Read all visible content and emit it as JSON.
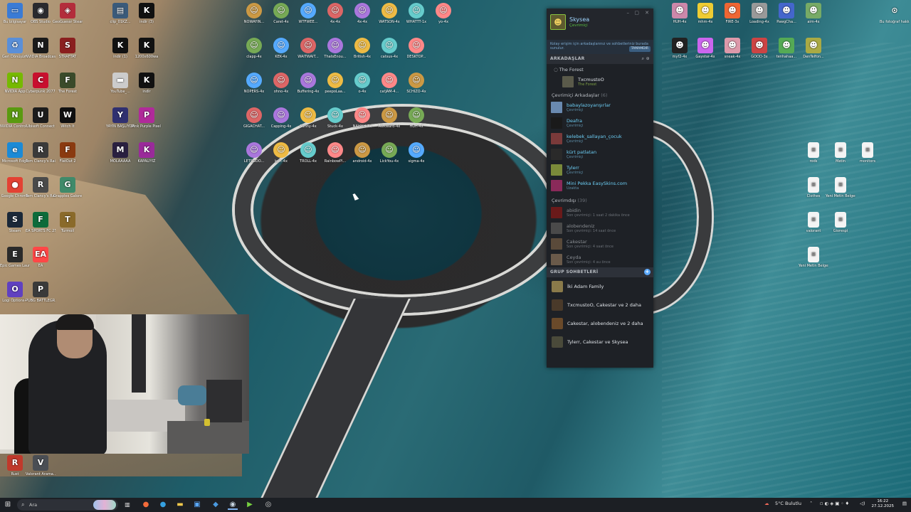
{
  "desktop_icons": [
    {
      "label": "Bu bilgisayar",
      "color": "#3a7bd5",
      "glyph": "▭"
    },
    {
      "label": "Geri Dönüşüm",
      "color": "#5a8fd8",
      "glyph": "♻"
    },
    {
      "label": "NVIDIA App",
      "color": "#76b900",
      "glyph": "N"
    },
    {
      "label": "NVIDIA Control...",
      "color": "#5a9a10",
      "glyph": "N"
    },
    {
      "label": "Microsoft Edge",
      "color": "#1b8ad6",
      "glyph": "e"
    },
    {
      "label": "Google Chrome",
      "color": "#e34133",
      "glyph": "●"
    },
    {
      "label": "Steam",
      "color": "#1b2838",
      "glyph": "S"
    },
    {
      "label": "Epic Games Launcher",
      "color": "#2a2a2a",
      "glyph": "E"
    },
    {
      "label": "Logi Options+",
      "color": "#6040c0",
      "glyph": "O"
    },
    {
      "label": "Rust",
      "color": "#c0392b",
      "glyph": "R"
    },
    {
      "label": "OBS Studio",
      "color": "#2a2a2e",
      "glyph": "◉"
    },
    {
      "label": "NVIDIA Broadcast",
      "color": "#1a1a1a",
      "glyph": "N"
    },
    {
      "label": "Cyberpunk 2077",
      "color": "#c8102e",
      "glyph": "C"
    },
    {
      "label": "Ubisoft Connect",
      "color": "#1c1c1c",
      "glyph": "U"
    },
    {
      "label": "Tom Clancy's Rainbow Si...",
      "color": "#3a3a3a",
      "glyph": "R"
    },
    {
      "label": "Tom Clancy's Rainbow Si...",
      "color": "#4a4a4a",
      "glyph": "R"
    },
    {
      "label": "EA SPORTS FC 25",
      "color": "#0d6b3a",
      "glyph": "F"
    },
    {
      "label": "EA",
      "color": "#ff4747",
      "glyph": "EA"
    },
    {
      "label": "PUBG BATTLEGR...",
      "color": "#3a3a3a",
      "glyph": "P"
    },
    {
      "label": "Valorant Arama...",
      "color": "#4a4e54",
      "glyph": "V"
    },
    {
      "label": "GeoGuessr Steam E...",
      "color": "#b32d3b",
      "glyph": "◈"
    },
    {
      "label": "STRAFTAT",
      "color": "#8a1f1f",
      "glyph": "S"
    },
    {
      "label": "The Forest",
      "color": "#3a4a2a",
      "glyph": "F"
    },
    {
      "label": "Witch It",
      "color": "#101010",
      "glyph": "W"
    },
    {
      "label": "FlatOut 2",
      "color": "#8a3a10",
      "glyph": "F"
    },
    {
      "label": "Grapples Galore",
      "color": "#3f8a6a",
      "glyph": "G"
    },
    {
      "label": "Turmoil",
      "color": "#8a6a2a",
      "glyph": "T"
    },
    {
      "label": "clip_01KZ...",
      "color": "#3a5a7a",
      "glyph": "▤"
    },
    {
      "label": "indir (1)",
      "color": "#111111",
      "glyph": "K"
    },
    {
      "label": "YouTube_...",
      "color": "#cccccc",
      "glyph": "▬"
    },
    {
      "label": "YAYIN BAŞLIYOR",
      "color": "#303070",
      "glyph": "Y"
    },
    {
      "label": "MOLAAAAA",
      "color": "#2a2040",
      "glyph": "M"
    },
    {
      "label": "indir (3)",
      "color": "#111111",
      "glyph": "K"
    },
    {
      "label": "1200x600wa",
      "color": "#111111",
      "glyph": "K"
    },
    {
      "label": "indir",
      "color": "#111111",
      "glyph": "K"
    },
    {
      "label": "Pink Purple Pixel Gami...",
      "color": "#b02a9a",
      "glyph": "P"
    },
    {
      "label": "KAPALIYIZ",
      "color": "#9a2a9a",
      "glyph": "K"
    }
  ],
  "emote_icons": [
    "NOWAYIN...",
    "Caret-4x",
    "WTFWEE...",
    "4x-4x",
    "4x-4x",
    "WATSON-4x",
    "WHATTT-1x",
    "yo-4x",
    "clapp-4x",
    "KEK-4x",
    "WAITWAIT...",
    "ThatsEnou...",
    "British-4x",
    "catsus-4x",
    "DESKTOP...",
    "NOPERS-4x",
    "ohno-4x",
    "Buffering-4x",
    "peepoLaa...",
    "o-4x",
    "catJAM-4...",
    "SCHIZO-4x",
    "GIGACHAT...",
    "Capping-4x",
    "Sunny-4x",
    "Stuck-4x",
    "NAHHH-3x",
    "Awkward-4x",
    "HUH-4x",
    "LETSGOO...",
    "kurt-4x",
    "TROLL-4x",
    "RainbowPl...",
    "android-4x",
    "LickYou-4x",
    "sigma-4x"
  ],
  "right_icons": [
    "HUH-4x",
    "mhm-4x",
    "FIRE-3x",
    "Loading-4x",
    "PawgCha...",
    "aim-4x",
    "Bu fotoğraf hakkında...",
    "myf2-4x",
    "Gaystar-4x",
    "sneak-4x",
    "GOOD-3x",
    "tenhahaa...",
    "DenTelfon..."
  ],
  "docs_icons": [
    "rods",
    "Metin",
    "monitors",
    "Clothes",
    "Yeni Metin Belgesi",
    "valorant",
    "Giorespi",
    "Yeni Metin Belgesi"
  ],
  "steam": {
    "user_name": "Skysea",
    "user_status": "Çevrimiçi",
    "banner_text": "Kolay erişim için arkadaşlarınız ve sohbetleriniz burada sunulur.",
    "banner_button": "TAMAMDIR",
    "friends_header": "ARKADAŞLAR",
    "game_group": "The Forest",
    "ingame_friend": {
      "name": "TxcmustoO",
      "sub": "The Forest"
    },
    "online_header": "Çevrimiçi Arkadaşlar",
    "online_count": "(6)",
    "online_friends": [
      {
        "name": "babaylazoyarışırlar",
        "sub": "Çevrimiçi",
        "color": "#6a8ab0"
      },
      {
        "name": "Deafra",
        "sub": "Çevrimiçi",
        "color": "#1a1a1a"
      },
      {
        "name": "kelebek_sallayan_çocuk",
        "sub": "Çevrimiçi",
        "color": "#7a3a3a"
      },
      {
        "name": "kürt patlatan",
        "sub": "Çevrimiçi",
        "color": "#2a2a2a"
      },
      {
        "name": "Tylerr",
        "sub": "Çevrimiçi",
        "color": "#7a8a3a"
      },
      {
        "name": "Mini Pekka EasySkins.com",
        "sub": "Uzakta",
        "color": "#8a2a5a"
      }
    ],
    "offline_header": "Çevrimdışı",
    "offline_count": "(39)",
    "offline_friends": [
      {
        "name": "abidin",
        "sub": "Son çevrimiçi: 1 saat 2 dakika önce",
        "color": "#6a1a1a"
      },
      {
        "name": "alobendeniz",
        "sub": "Son çevrimiçi: 14 saat önce",
        "color": "#4a4a4a"
      },
      {
        "name": "Cakestar",
        "sub": "Son çevrimiçi: 4 saat önce",
        "color": "#5a4a3a"
      },
      {
        "name": "Ceyda",
        "sub": "Son çevrimiçi: 4 au önce",
        "color": "#6a5a4a"
      }
    ],
    "groups_header": "GRUP SOHBETLERİ",
    "groups": [
      {
        "name": "İki Adam Family",
        "color": "#8a7a4a"
      },
      {
        "name": "TxcmustoO, Cakestar ve 2 daha",
        "color": "#4a3a2a"
      },
      {
        "name": "Cakestar, alobendeniz ve 2 daha",
        "color": "#6a4a2a"
      },
      {
        "name": "Tylerr, Cakestar ve Skysea",
        "color": "#4a4a3a"
      }
    ]
  },
  "taskbar": {
    "search_placeholder": "Ara",
    "weather": "5°C Bulutlu",
    "time": "16:22",
    "date": "27.12.2025"
  }
}
